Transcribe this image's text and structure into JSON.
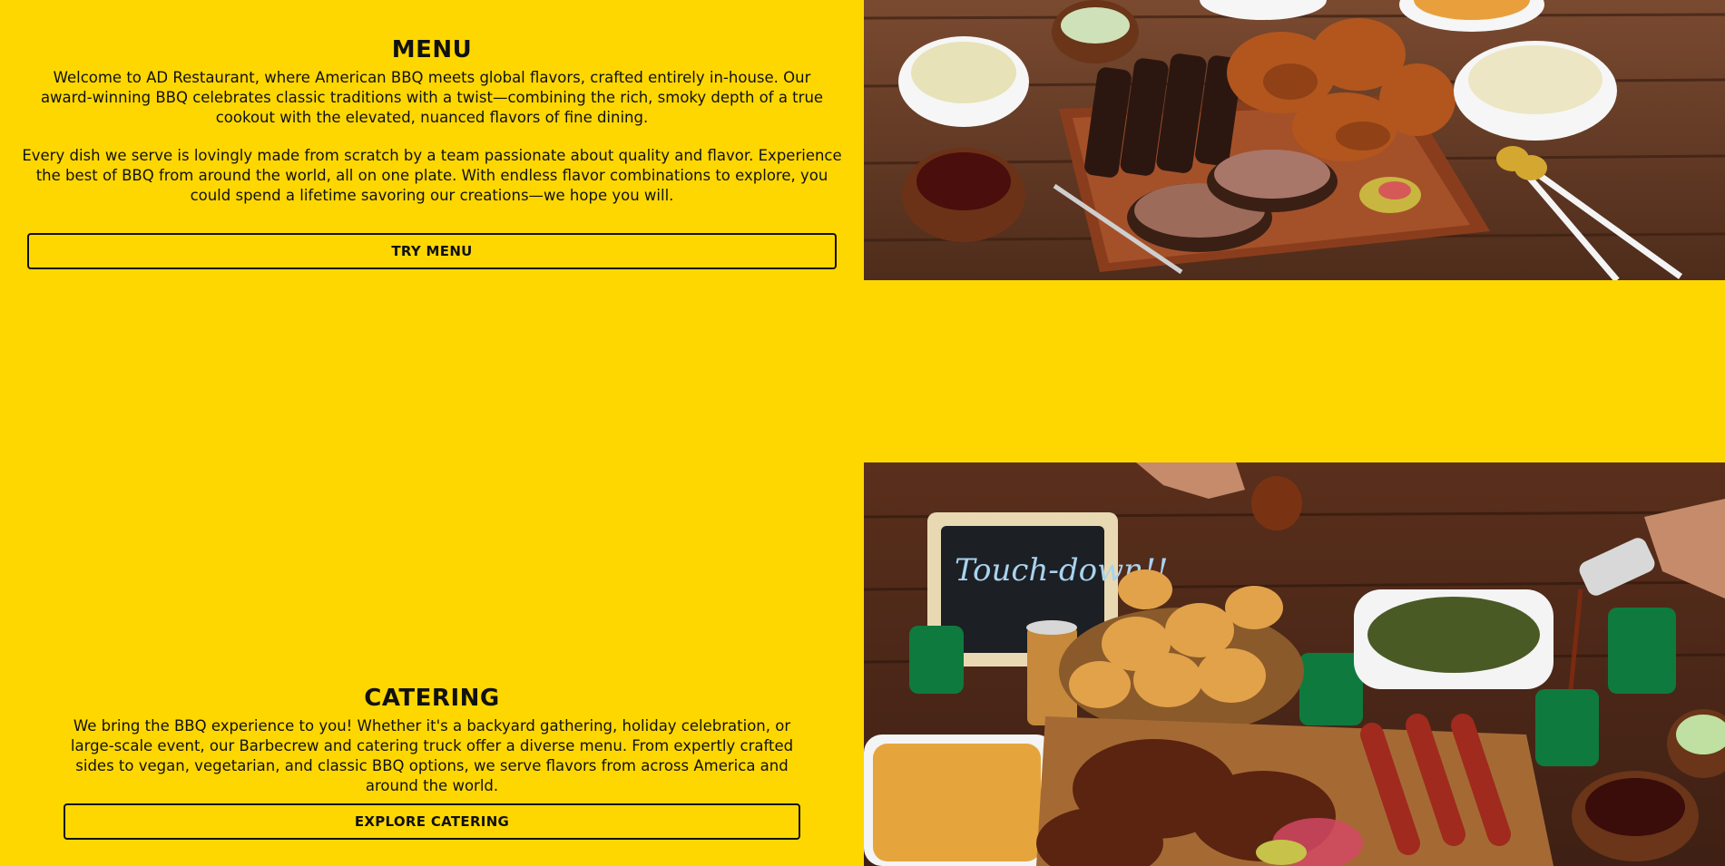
{
  "menu": {
    "title": "MENU",
    "paragraph_1": "Welcome to AD Restaurant, where American BBQ meets global flavors, crafted entirely in-house. Our award-winning BBQ celebrates classic traditions with a twist—combining the rich, smoky depth of a true cookout with the elevated, nuanced flavors of fine dining.",
    "paragraph_2": "Every dish we serve is lovingly made from scratch by a team passionate about quality and flavor. Experience the best of BBQ from around the world, all on one plate. With endless flavor combinations to explore, you could spend a lifetime savoring our creations—we hope you will.",
    "button_label": "TRY MENU"
  },
  "catering": {
    "title": "CATERING",
    "paragraph": "We bring the BBQ experience to you! Whether it's a backyard gathering, holiday celebration, or large-scale event, our Barbecrew and catering truck offer a diverse menu. From expertly crafted sides to vegan, vegetarian, and classic BBQ options, we serve flavors from across America and around the world.",
    "button_label": "EXPLORE CATERING",
    "chalkboard_text": "Touch-down!!"
  },
  "colors": {
    "background": "#FFD700",
    "text": "#111111",
    "wood": "#6B3A22"
  }
}
